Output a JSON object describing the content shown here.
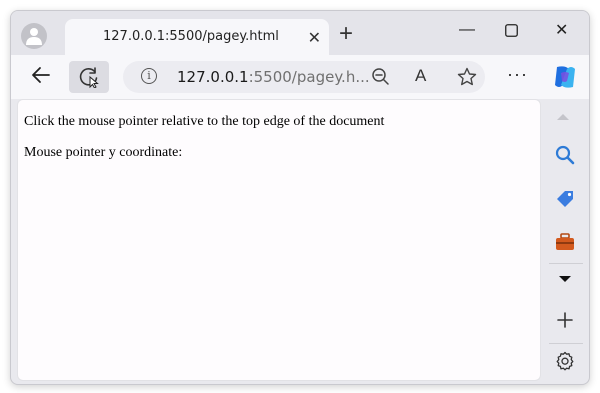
{
  "tab": {
    "title": "127.0.0.1:5500/pagey.html",
    "close": "✕",
    "new_tab": "+"
  },
  "window_controls": {
    "minimize": "—",
    "maximize": "☐",
    "close": "✕"
  },
  "address_bar": {
    "host": "127.0.0.1",
    "rest": ":5500/pagey.h..."
  },
  "toolbar": {
    "more": "···",
    "read_aloud": "A"
  },
  "page": {
    "instruction": "Click the mouse pointer relative to the top edge of the document",
    "result_label": "Mouse pointer y coordinate:"
  },
  "colors": {
    "accent": "#1f6fe0",
    "chrome_bg": "#e4e4ea",
    "tab_bg": "#f7f7fa",
    "toolbox": "#d35a1e"
  }
}
